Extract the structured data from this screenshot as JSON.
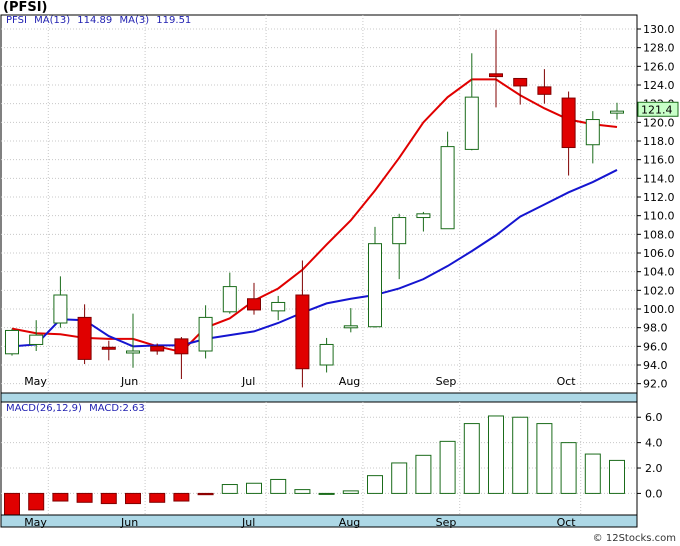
{
  "title": "(PFSI)",
  "legend": {
    "ticker": "PFSI",
    "ma13_label": "MA(13)",
    "ma13_value": "114.89",
    "ma3_label": "MA(3)",
    "ma3_value": "119.51"
  },
  "last_price_label": "121.4",
  "macd_legend": {
    "label": "MACD(26,12,9)",
    "value_label": "MACD:2.63"
  },
  "credit": "© 12Stocks.com",
  "colors": {
    "up_candle": "#1a6b1a",
    "down_candle": "#e00000",
    "ma3": "#e00000",
    "ma13": "#1515d0",
    "band": "#add8e6",
    "price_box": "#c8ffc8"
  },
  "chart_data": [
    {
      "type": "candlestick",
      "ylim": [
        91,
        131.5
      ],
      "yticks": [
        "92.0",
        "94.0",
        "96.0",
        "98.0",
        "100.0",
        "102.0",
        "104.0",
        "106.0",
        "108.0",
        "110.0",
        "112.0",
        "114.0",
        "116.0",
        "118.0",
        "120.0",
        "122.0",
        "124.0",
        "126.0",
        "128.0",
        "130.0"
      ],
      "x_labels": [
        "May",
        "Jun",
        "Jul",
        "Aug",
        "Sep",
        "Oct"
      ],
      "x_label_index": [
        1,
        5,
        10,
        14,
        18,
        23
      ],
      "candles": [
        {
          "o": 95.2,
          "h": 97.9,
          "l": 95.0,
          "c": 97.7
        },
        {
          "o": 96.2,
          "h": 98.8,
          "l": 95.5,
          "c": 97.2
        },
        {
          "o": 98.5,
          "h": 103.5,
          "l": 98.0,
          "c": 101.5
        },
        {
          "o": 99.1,
          "h": 100.5,
          "l": 94.1,
          "c": 94.6
        },
        {
          "o": 95.9,
          "h": 96.6,
          "l": 94.5,
          "c": 95.8
        },
        {
          "o": 95.3,
          "h": 99.5,
          "l": 93.7,
          "c": 95.5
        },
        {
          "o": 96.0,
          "h": 96.3,
          "l": 95.1,
          "c": 95.5
        },
        {
          "o": 96.8,
          "h": 97.0,
          "l": 92.5,
          "c": 95.2
        },
        {
          "o": 95.5,
          "h": 100.4,
          "l": 94.7,
          "c": 99.1
        },
        {
          "o": 99.7,
          "h": 103.9,
          "l": 99.5,
          "c": 102.4
        },
        {
          "o": 101.1,
          "h": 102.8,
          "l": 99.4,
          "c": 99.9
        },
        {
          "o": 99.8,
          "h": 101.4,
          "l": 98.8,
          "c": 100.7
        },
        {
          "o": 101.5,
          "h": 105.2,
          "l": 91.6,
          "c": 93.6
        },
        {
          "o": 94.0,
          "h": 96.9,
          "l": 93.2,
          "c": 96.2
        },
        {
          "o": 98.1,
          "h": 100.1,
          "l": 97.5,
          "c": 98.2
        },
        {
          "o": 98.1,
          "h": 108.8,
          "l": 98.0,
          "c": 107.0
        },
        {
          "o": 107.0,
          "h": 110.2,
          "l": 103.2,
          "c": 109.8
        },
        {
          "o": 109.8,
          "h": 110.4,
          "l": 108.3,
          "c": 110.2
        },
        {
          "o": 108.6,
          "h": 119.0,
          "l": 108.6,
          "c": 117.4
        },
        {
          "o": 117.1,
          "h": 127.4,
          "l": 117.0,
          "c": 122.7
        },
        {
          "o": 125.2,
          "h": 129.9,
          "l": 121.6,
          "c": 124.9
        },
        {
          "o": 124.7,
          "h": 124.7,
          "l": 121.9,
          "c": 123.9
        },
        {
          "o": 123.8,
          "h": 125.7,
          "l": 122.0,
          "c": 123.0
        },
        {
          "o": 122.6,
          "h": 123.3,
          "l": 114.3,
          "c": 117.3
        },
        {
          "o": 117.6,
          "h": 121.2,
          "l": 115.6,
          "c": 120.3
        },
        {
          "o": 121.1,
          "h": 122.1,
          "l": 120.3,
          "c": 121.2
        }
      ],
      "ma3": [
        null,
        null,
        99.3,
        99.0,
        98.7,
        97.9,
        97.4,
        97.3,
        96.9,
        96.8,
        96.8,
        96.0,
        95.4,
        98.0,
        99.0,
        100.9,
        102.2,
        104.2,
        106.9,
        109.5,
        112.7,
        116.2,
        120.0,
        122.7,
        124.6,
        124.6,
        122.9,
        121.5,
        120.3,
        119.8,
        119.5
      ],
      "ma13": [
        96.0,
        96.2,
        98.9,
        98.8,
        97.1,
        96.0,
        96.1,
        96.1,
        96.8,
        97.2,
        97.6,
        98.5,
        99.6,
        100.6,
        101.1,
        101.5,
        102.2,
        103.2,
        104.6,
        106.2,
        107.9,
        109.9,
        111.2,
        112.5,
        113.6,
        114.9
      ]
    },
    {
      "type": "bar",
      "name": "MACD(26,12,9)",
      "ylim": [
        -1.7,
        7.2
      ],
      "yticks": [
        "0.0",
        "2.0",
        "4.0",
        "6.0"
      ],
      "values": [
        -1.8,
        -1.3,
        -0.6,
        -0.7,
        -0.8,
        -0.8,
        -0.7,
        -0.6,
        -0.1,
        0.7,
        0.8,
        1.1,
        0.3,
        0.0,
        0.2,
        1.4,
        2.4,
        3.0,
        4.1,
        5.5,
        6.1,
        6.0,
        5.5,
        4.0,
        3.1,
        2.6
      ]
    }
  ]
}
